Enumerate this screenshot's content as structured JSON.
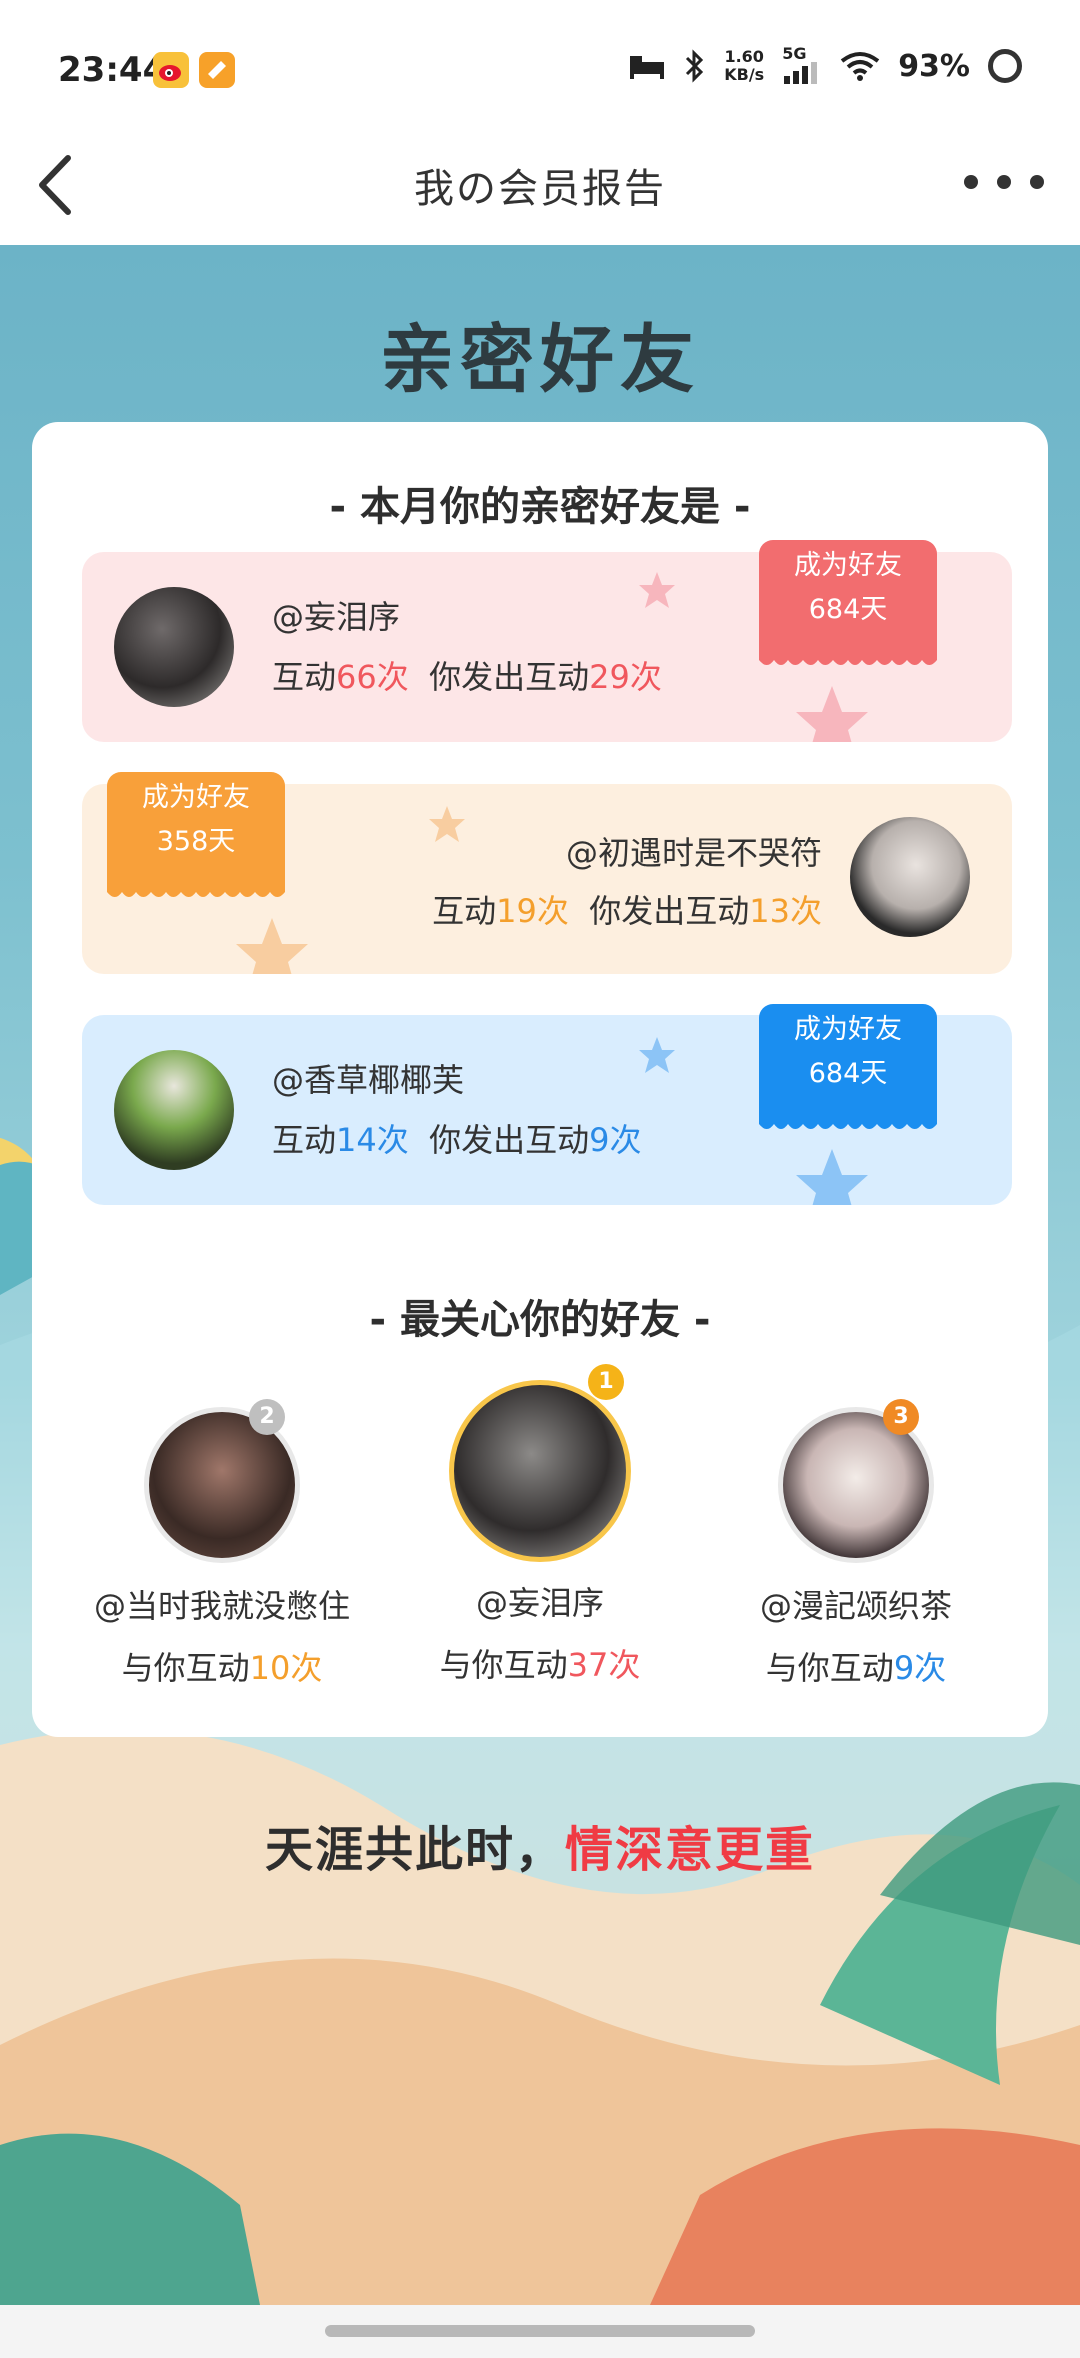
{
  "status_bar": {
    "time": "23:44",
    "net_speed": "1.60",
    "net_unit": "KB/s",
    "network": "5G",
    "battery": "93%"
  },
  "nav": {
    "title": "我の会员报告"
  },
  "hero": {
    "title": "亲密好友"
  },
  "intimate": {
    "title": "-  本月你的亲密好友是  -",
    "friends": [
      {
        "name": "@妄泪序",
        "stat_prefix": "互动",
        "count": "66次",
        "sent_prefix": "你发出互动",
        "sent": "29次",
        "badge_line1": "成为好友",
        "badge_line2": "684天",
        "color": "#f26d6f"
      },
      {
        "name": "@初遇时是不哭符",
        "stat_prefix": "互动",
        "count": "19次",
        "sent_prefix": "你发出互动",
        "sent": "13次",
        "badge_line1": "成为好友",
        "badge_line2": "358天",
        "color": "#f8a03a"
      },
      {
        "name": "@香草椰椰芙",
        "stat_prefix": "互动",
        "count": "14次",
        "sent_prefix": "你发出互动",
        "sent": "9次",
        "badge_line1": "成为好友",
        "badge_line2": "684天",
        "color": "#1a8ef0"
      }
    ]
  },
  "caring": {
    "title": "-  最关心你的好友  -",
    "ranks": [
      {
        "rank": "2",
        "name": "@当时我就没憋住",
        "prefix": "与你互动",
        "count": "10次"
      },
      {
        "rank": "1",
        "name": "@妄泪序",
        "prefix": "与你互动",
        "count": "37次"
      },
      {
        "rank": "3",
        "name": "@漫記颂织茶",
        "prefix": "与你互动",
        "count": "9次"
      }
    ]
  },
  "slogan": {
    "part1": "天涯共此时，",
    "part2": "情深意更重"
  }
}
